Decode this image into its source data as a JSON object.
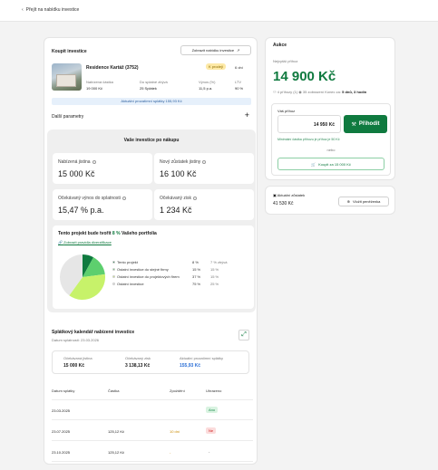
{
  "nav": {
    "back_label": "Přejít na nabídku investice"
  },
  "purchase": {
    "title": "Koupit investice",
    "compare_label": "Zobrazit nabídku investice",
    "property_name": "Residence Kartáž (3752)",
    "badge": "K prodeji",
    "remaining": "6 dní",
    "offer_price_label": "Nabízená částka",
    "offer_price_value": "19 000 Kč",
    "installments_label": "Do splatné zbývá",
    "installments_value": "25 Splátek",
    "yield_label": "Výnos (%)",
    "yield_value": "11,5 p.a.",
    "ltv_label": "LTV",
    "ltv_value": "90 %",
    "notice": "Aktuální prozatímní splátky 155,93 Kč",
    "more_label": "Další parametry",
    "more_icon": "plus-icon"
  },
  "summary": {
    "title": "Vaše investice po nákupu",
    "stats": [
      {
        "label": "Nabízená jistina",
        "value": "15 000 Kč"
      },
      {
        "label": "Nový zůstatek jistiny",
        "value": "16 100 Kč"
      },
      {
        "label": "Očekávaný výnos do splatnosti",
        "value": "15,47 % p.a."
      },
      {
        "label": "Očekávaný zisk",
        "value": "1 234 Kč"
      }
    ],
    "diversify_title_pre": "Tento projekt bude tvořit",
    "diversify_pct": "8 %",
    "diversify_title_post": "Vašeho portfolia",
    "diversify_link": "Zobrazit pravidla diverzifikace",
    "legend": [
      {
        "name": "Tento projekt",
        "a": "8 %",
        "b": "7 % zbývá",
        "color": "#0f7a3f"
      },
      {
        "name": "Ostatní investice do stejné firmy",
        "a": "15 %",
        "b": "15 %",
        "color": "#5dcf6e"
      },
      {
        "name": "Ostatní investice do projektových firem",
        "a": "37 %",
        "b": "15 %",
        "color": "#c7f26a"
      },
      {
        "name": "Ostatní investice",
        "a": "75 %",
        "b": "25 %",
        "color": "#e6e6e6"
      }
    ],
    "pie": [
      8,
      15,
      37,
      40
    ]
  },
  "calendar": {
    "title": "Splátkový kalendář nabízené investice",
    "subtitle": "Datum splatnosti: 23.03.2026",
    "boxes": [
      {
        "label": "Očekávaná jistina",
        "value": "15 000 Kč"
      },
      {
        "label": "Očekávaný zisk",
        "value": "3 138,13 Kč"
      },
      {
        "label": "Aktuální prozatímní splátky",
        "value": "155,93 Kč"
      }
    ],
    "headers": [
      "Datum splátky",
      "Částka",
      "Zpoždění",
      "Uhrazeno"
    ],
    "rows": [
      {
        "date": "23.03.2025",
        "amount": "",
        "delay": "",
        "paid": "Ano",
        "paid_color": "#1a8a4a",
        "paid_bg": "#d9f3e1"
      },
      {
        "date": "23.07.2025",
        "amount": "125,12 Kč",
        "delay": "10 dní",
        "paid": "Ne",
        "paid_color": "#d02020",
        "paid_bg": "#fbdcdc"
      },
      {
        "date": "23.10.2025",
        "amount": "125,12 Kč",
        "delay": "-",
        "paid": "-",
        "paid_color": "#333",
        "paid_bg": "transparent"
      }
    ]
  },
  "auction": {
    "title": "Aukce",
    "best_label": "Nejvyšší příhoz",
    "best_value": "14 900 Kč",
    "meta_bids": "4 příhozy (1)",
    "meta_watch": "35 zobrazení",
    "meta_end_pre": "Konec za:",
    "meta_end": "5 dnů, 3 hodin",
    "input_label": "Váš příhoz",
    "input_value": "14 950 Kč",
    "bid_label": "Přihodit",
    "hint": "Minimální částka příhozu je příhoz je 50 Kč",
    "or": "nebo",
    "buy_label": "Koupit za 15 000 Kč"
  },
  "balance": {
    "label": "Aktuální zůstatek",
    "value": "41 530 Kč",
    "deposit_label": "Vložit peněženka"
  }
}
